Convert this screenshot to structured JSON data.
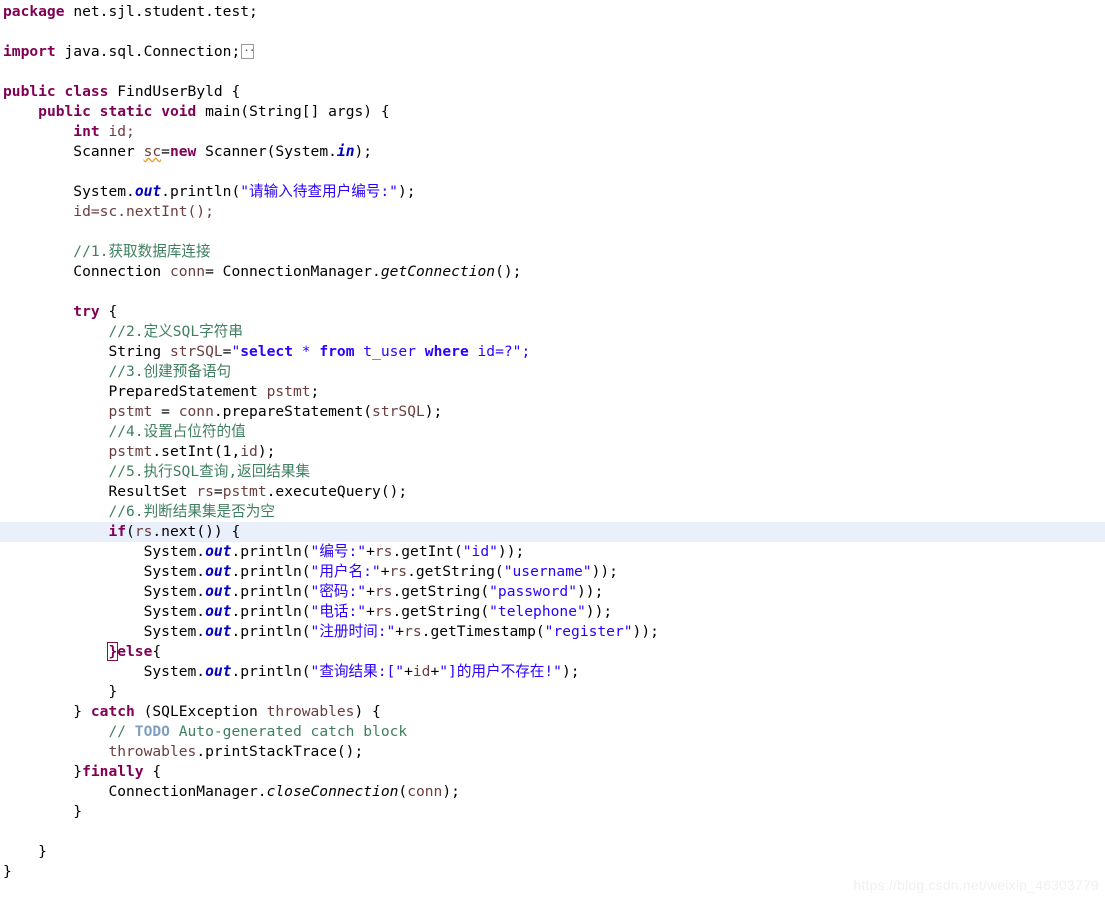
{
  "editor": {
    "language": "java",
    "class_name": "FindUserByld",
    "highlight_color": "#e9f0fb",
    "colors": {
      "background": "#ffffff",
      "keyword": "#7f0055",
      "comment": "#3f7f5f",
      "string": "#2a00ff",
      "static_field": "#0000c0",
      "local_variable": "#6a3e3e",
      "todo_tag": "#7f9fbf",
      "warning_squiggle": "#e8a33d",
      "bracket_match_outline": "#8b0f3c",
      "watermark": "#f0f0f0"
    },
    "lines": [
      {
        "n": 1,
        "indent": 0,
        "text": "package net.sjl.student.test;"
      },
      {
        "n": 2,
        "indent": 0,
        "text": ""
      },
      {
        "n": 3,
        "indent": 0,
        "text": "import java.sql.Connection;"
      },
      {
        "n": 4,
        "indent": 0,
        "text": ""
      },
      {
        "n": 5,
        "indent": 0,
        "text": "public class FindUserByld {"
      },
      {
        "n": 6,
        "indent": 1,
        "text": "public static void main(String[] args) {"
      },
      {
        "n": 7,
        "indent": 2,
        "text": "int id;"
      },
      {
        "n": 8,
        "indent": 2,
        "text": "Scanner sc=new Scanner(System.in);"
      },
      {
        "n": 9,
        "indent": 0,
        "text": ""
      },
      {
        "n": 10,
        "indent": 2,
        "text": "System.out.println(\"请输入待查用户编号:\");"
      },
      {
        "n": 11,
        "indent": 2,
        "text": "id=sc.nextInt();"
      },
      {
        "n": 12,
        "indent": 0,
        "text": ""
      },
      {
        "n": 13,
        "indent": 2,
        "text": "//1.获取数据库连接"
      },
      {
        "n": 14,
        "indent": 2,
        "text": "Connection conn= ConnectionManager.getConnection();"
      },
      {
        "n": 15,
        "indent": 0,
        "text": ""
      },
      {
        "n": 16,
        "indent": 2,
        "text": "try {"
      },
      {
        "n": 17,
        "indent": 3,
        "text": "//2.定义SQL字符串"
      },
      {
        "n": 18,
        "indent": 3,
        "text": "String strSQL=\"select * from t_user where id=?\";"
      },
      {
        "n": 19,
        "indent": 3,
        "text": "//3.创建预备语句"
      },
      {
        "n": 20,
        "indent": 3,
        "text": "PreparedStatement pstmt;"
      },
      {
        "n": 21,
        "indent": 3,
        "text": "pstmt = conn.prepareStatement(strSQL);"
      },
      {
        "n": 22,
        "indent": 3,
        "text": "//4.设置占位符的值"
      },
      {
        "n": 23,
        "indent": 3,
        "text": "pstmt.setInt(1,id);"
      },
      {
        "n": 24,
        "indent": 3,
        "text": "//5.执行SQL查询,返回结果集"
      },
      {
        "n": 25,
        "indent": 3,
        "text": "ResultSet rs=pstmt.executeQuery();"
      },
      {
        "n": 26,
        "indent": 3,
        "text": "//6.判断结果集是否为空"
      },
      {
        "n": 27,
        "indent": 3,
        "text": "if(rs.next()) {",
        "highlighted": true
      },
      {
        "n": 28,
        "indent": 4,
        "text": "System.out.println(\"编号:\"+rs.getInt(\"id\"));"
      },
      {
        "n": 29,
        "indent": 4,
        "text": "System.out.println(\"用户名:\"+rs.getString(\"username\"));"
      },
      {
        "n": 30,
        "indent": 4,
        "text": "System.out.println(\"密码:\"+rs.getString(\"password\"));"
      },
      {
        "n": 31,
        "indent": 4,
        "text": "System.out.println(\"电话:\"+rs.getString(\"telephone\"));"
      },
      {
        "n": 32,
        "indent": 4,
        "text": "System.out.println(\"注册时间:\"+rs.getTimestamp(\"register\"));"
      },
      {
        "n": 33,
        "indent": 3,
        "text": "}else{"
      },
      {
        "n": 34,
        "indent": 4,
        "text": "System.out.println(\"查询结果:[\"+id+\"]的用户不存在!\");"
      },
      {
        "n": 35,
        "indent": 3,
        "text": "}"
      },
      {
        "n": 36,
        "indent": 2,
        "text": "} catch (SQLException throwables) {"
      },
      {
        "n": 37,
        "indent": 3,
        "text": "// TODO Auto-generated catch block"
      },
      {
        "n": 38,
        "indent": 3,
        "text": "throwables.printStackTrace();"
      },
      {
        "n": 39,
        "indent": 2,
        "text": "}finally {"
      },
      {
        "n": 40,
        "indent": 3,
        "text": "ConnectionManager.closeConnection(conn);"
      },
      {
        "n": 41,
        "indent": 2,
        "text": "}"
      },
      {
        "n": 42,
        "indent": 0,
        "text": ""
      },
      {
        "n": 43,
        "indent": 1,
        "text": "}"
      },
      {
        "n": 44,
        "indent": 0,
        "text": "}"
      }
    ],
    "tokens": {
      "kw_package": "package",
      "kw_import": "import",
      "kw_public": "public",
      "kw_class": "class",
      "kw_static": "static",
      "kw_void": "void",
      "kw_int": "int",
      "kw_new": "new",
      "kw_try": "try",
      "kw_catch": "catch",
      "kw_else": "else",
      "kw_finally": "finally",
      "kw_if": "if",
      "package_name": "net.sjl.student.test;",
      "import_name": "java.sql.Connection;",
      "class_decl_name": "FindUserByld {",
      "main_sig": "main(String[] args) {",
      "int_var": "id;",
      "scanner_type": "Scanner ",
      "scanner_var": "sc",
      "scanner_assign": "=",
      "scanner_ctor": " Scanner(System.",
      "scanner_in": "in",
      "scanner_tail": ");",
      "println_prefix": "System.",
      "out_field": "out",
      "println_call": ".println(",
      "str_prompt": "\"请输入待查用户编号:\"",
      "close_stmt": ");",
      "id_next_int": "id=sc.nextInt();",
      "cmt_1": "//1.获取数据库连接",
      "conn_decl_a": "Connection ",
      "conn_var": "conn",
      "conn_decl_b": "= ConnectionManager.",
      "conn_method": "getConnection",
      "conn_tail": "();",
      "try_open": " {",
      "cmt_2": "//2.定义SQL字符串",
      "string_decl": "String ",
      "strsql_var": "strSQL",
      "strsql_eq": "=",
      "sql_q1": "\"",
      "sql_select": "select",
      "sql_star": " * ",
      "sql_from": "from",
      "sql_table": " t_user ",
      "sql_where": "where",
      "sql_cond": " id=?",
      "sql_q2": "\";",
      "cmt_3": "//3.创建预备语句",
      "pstmt_decl_type": "PreparedStatement ",
      "pstmt_var": "pstmt",
      "pstmt_semi": ";",
      "pstmt_assign_a": "pstmt",
      "pstmt_assign_b": " = ",
      "pstmt_assign_c": "conn",
      "pstmt_assign_d": ".prepareStatement(",
      "pstmt_assign_e": "strSQL",
      "pstmt_assign_f": ");",
      "cmt_4": "//4.设置占位符的值",
      "setint_a": "pstmt",
      "setint_b": ".setInt(1,",
      "setint_c": "id",
      "setint_d": ");",
      "cmt_5": "//5.执行SQL查询,返回结果集",
      "rs_type": "ResultSet ",
      "rs_var": "rs",
      "rs_eq": "=",
      "rs_pstmt": "pstmt",
      "rs_exec": ".executeQuery();",
      "cmt_6": "//6.判断结果集是否为空",
      "if_open": "(",
      "if_rs": "rs",
      "if_next": ".next()) {",
      "str_bianhao": "\"编号:\"",
      "plus": "+",
      "rs_ref": "rs",
      "get_int": ".getInt(",
      "str_id": "\"id\"",
      "close2": "));",
      "str_username_label": "\"用户名:\"",
      "get_string": ".getString(",
      "str_username": "\"username\"",
      "str_password_label": "\"密码:\"",
      "str_password": "\"password\"",
      "str_telephone_label": "\"电话:\"",
      "str_telephone": "\"telephone\"",
      "str_register_label": "\"注册时间:\"",
      "get_timestamp": ".getTimestamp(",
      "str_register": "\"register\"",
      "brace_close": "}",
      "else_open": "{",
      "str_notfound_a": "\"查询结果:[\"",
      "notfound_id": "id",
      "str_notfound_b": "\"]的用户不存在!\"",
      "catch_head": "} ",
      "catch_sig": " (SQLException ",
      "catch_var": "throwables",
      "catch_tail": ") {",
      "cmt_slashes": "// ",
      "todo_tag": "TODO",
      "cmt_todo_rest": " Auto-generated catch block",
      "throwables_ref": "throwables",
      "print_stack": ".printStackTrace();",
      "finally_brace": "}",
      "finally_tail": " {",
      "cm_cls": "ConnectionManager.",
      "close_conn": "closeConnection",
      "close_conn_open": "(",
      "close_conn_arg": "conn",
      "close_conn_end": ");"
    }
  },
  "watermark": {
    "text": "https://blog.csdn.net/weixin_46303779"
  }
}
